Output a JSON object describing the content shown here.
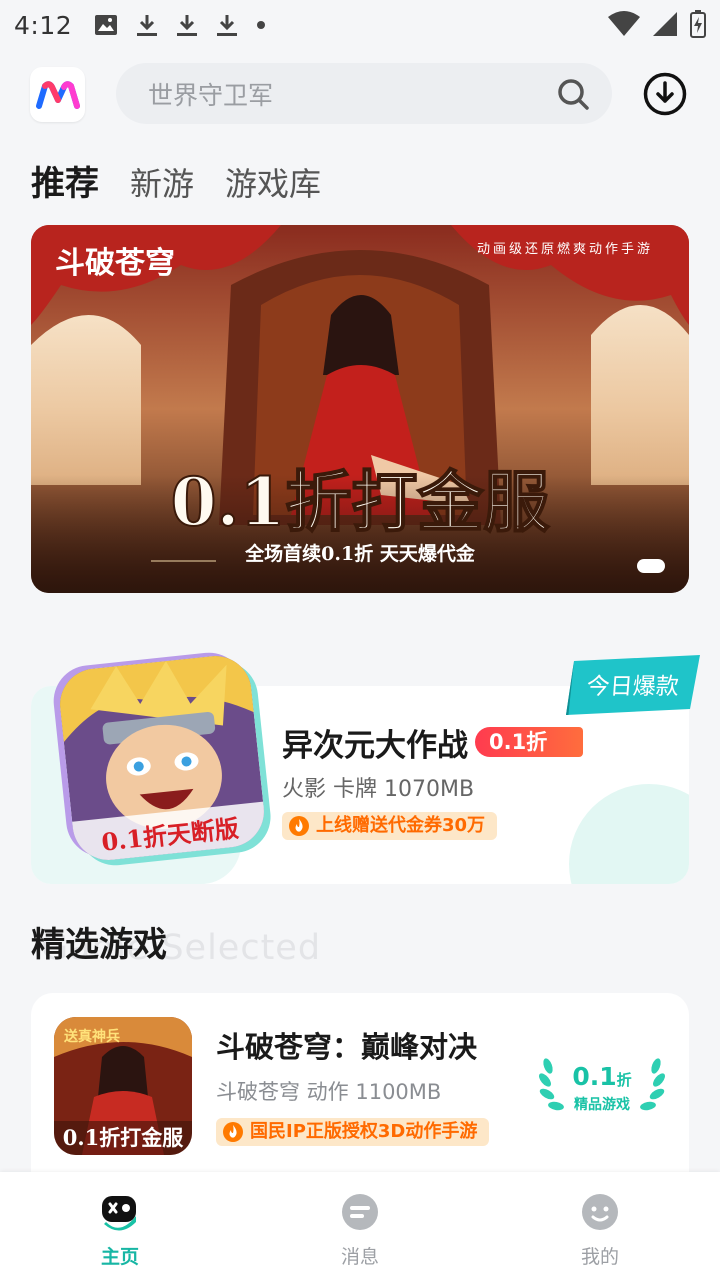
{
  "status_bar": {
    "time": "4:12",
    "icons_left": [
      "image-icon",
      "download-icon",
      "download-icon",
      "download-icon",
      "dot-icon"
    ],
    "icons_right": [
      "wifi-icon",
      "signal-icon",
      "battery-icon"
    ]
  },
  "header": {
    "logo": "app-logo-icon",
    "search_placeholder": "世界守卫军",
    "download_icon": "download-circle-icon"
  },
  "tabs": [
    {
      "label": "推荐",
      "active": true
    },
    {
      "label": "新游",
      "active": false
    },
    {
      "label": "游戏库",
      "active": false
    }
  ],
  "banner": {
    "logo_text": "斗破苍穹",
    "tagline": "动画级还原燃爽动作手游",
    "headline": "0.1折打金服",
    "subline": "全场首续0.1折 天天爆代金",
    "slides_total": 1
  },
  "hot_card": {
    "badge": "今日爆款",
    "title": "异次元大作战",
    "discount": "0.1折",
    "meta": "火影 卡牌 1070MB",
    "promo": "上线赠送代金券30万",
    "icon_caption": "0.1折天断版"
  },
  "section": {
    "title": "精选游戏",
    "title_en": "Game Selected"
  },
  "game_list": [
    {
      "title": "斗破苍穹：巅峰对决",
      "meta": "斗破苍穹 动作 1100MB",
      "promo": "国民IP正版授权3D动作手游",
      "icon_caption": "0.1折打金服",
      "icon_tag": "送真神兵",
      "discount_value": "0.1",
      "discount_unit": "折",
      "discount_caption": "精品游戏"
    }
  ],
  "bottom_nav": [
    {
      "label": "主页",
      "icon": "game-controller-icon",
      "active": true
    },
    {
      "label": "消息",
      "icon": "message-icon",
      "active": false
    },
    {
      "label": "我的",
      "icon": "profile-face-icon",
      "active": false
    }
  ],
  "colors": {
    "accent": "#17b6a4",
    "discount_red": "#ff3b4f",
    "promo_orange": "#ff6a00",
    "promo_bg": "#fde7c8"
  }
}
